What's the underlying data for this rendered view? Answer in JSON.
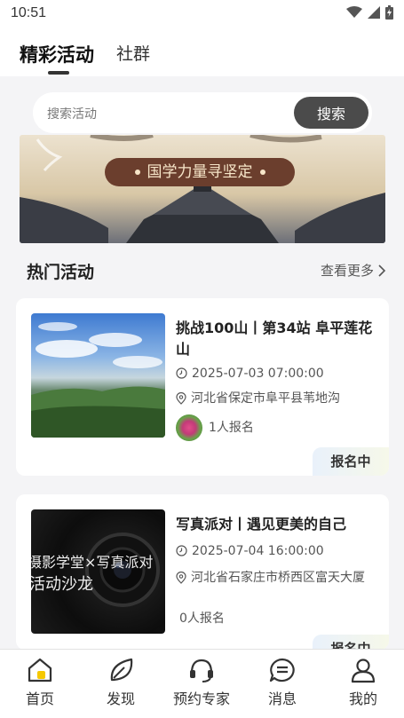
{
  "status_bar": {
    "time": "10:51"
  },
  "tabs": [
    {
      "label": "精彩活动"
    },
    {
      "label": "社群"
    }
  ],
  "search": {
    "placeholder": "搜索活动",
    "button_label": "搜索"
  },
  "banner": {
    "text": "国学力量寻坚定"
  },
  "section": {
    "title": "热门活动",
    "see_more": "查看更多"
  },
  "activities": [
    {
      "title": "挑战100山丨第34站 阜平莲花山",
      "datetime": "2025-07-03 07:00:00",
      "location": "河北省保定市阜平县苇地沟",
      "signups": "1人报名",
      "status": "报名中"
    },
    {
      "title": "写真派对丨遇见更美的自己",
      "datetime": "2025-07-04 16:00:00",
      "location": "河北省石家庄市桥西区富天大厦",
      "signups": "0人报名",
      "status": "报名中",
      "thumb_text_1": "摄影学堂×写真派对",
      "thumb_text_2": "活动沙龙"
    }
  ],
  "bottom_nav": [
    {
      "label": "首页",
      "icon": "home-icon"
    },
    {
      "label": "发现",
      "icon": "leaf-icon"
    },
    {
      "label": "预约专家",
      "icon": "headset-icon"
    },
    {
      "label": "消息",
      "icon": "message-icon"
    },
    {
      "label": "我的",
      "icon": "user-icon"
    }
  ],
  "colors": {
    "accent": "#f6c800",
    "dark_button": "#4b4b4b",
    "badge_bg_start": "#e9f1fb",
    "badge_bg_end": "#f6f8e9"
  }
}
